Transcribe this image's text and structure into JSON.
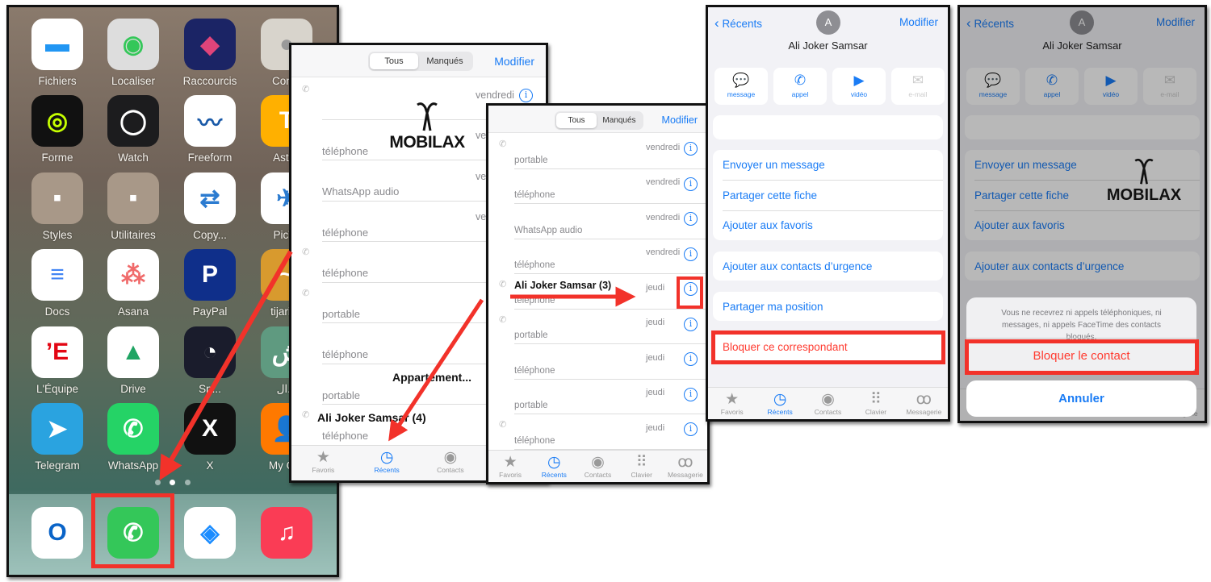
{
  "home": {
    "apps": [
      {
        "label": "Fichiers",
        "icon": "folder-icon",
        "color": "#2196f3",
        "bg": "#fff"
      },
      {
        "label": "Localiser",
        "icon": "find-my-icon",
        "color": "#34c759",
        "bg": "#ddd"
      },
      {
        "label": "Raccourcis",
        "icon": "shortcuts-icon",
        "color": "#e0447a",
        "bg": "#1b2465"
      },
      {
        "label": "Conta",
        "icon": "contacts-icon",
        "color": "#999",
        "bg": "#d8d4cc"
      },
      {
        "label": "Forme",
        "icon": "fitness-rings-icon",
        "color": "#c6ff00",
        "bg": "#111"
      },
      {
        "label": "Watch",
        "icon": "watch-icon",
        "color": "#fff",
        "bg": "#1c1c1e"
      },
      {
        "label": "Freeform",
        "icon": "freeform-icon",
        "color": "#1a5aa8",
        "bg": "#fff"
      },
      {
        "label": "Astuc",
        "icon": "tips-lightbulb-icon",
        "color": "#fff",
        "bg": "#ffb000"
      },
      {
        "label": "Styles",
        "icon": "folder-styles-icon",
        "color": "#fff",
        "bg": "#a89888"
      },
      {
        "label": "Utilitaires",
        "icon": "folder-utilities-icon",
        "color": "#fff",
        "bg": "#a89888"
      },
      {
        "label": "Copy...",
        "icon": "copy-data-icon",
        "color": "#2b7bd0",
        "bg": "#fff",
        "cloud": true
      },
      {
        "label": "PicTo",
        "icon": "rocket-icon",
        "color": "#2b7bd0",
        "bg": "#fff"
      },
      {
        "label": "Docs",
        "icon": "google-docs-icon",
        "color": "#4285f4",
        "bg": "#fff"
      },
      {
        "label": "Asana",
        "icon": "asana-icon",
        "color": "#f06a6a",
        "bg": "#fff",
        "cloud": true
      },
      {
        "label": "PayPal",
        "icon": "paypal-icon",
        "color": "#fff",
        "bg": "#0f2f8a"
      },
      {
        "label": "tijari M",
        "icon": "attijari-icon",
        "color": "#fff",
        "bg": "#d89a2e"
      },
      {
        "label": "L'Équipe",
        "icon": "lequipe-icon",
        "color": "#e30613",
        "bg": "#fff"
      },
      {
        "label": "Drive",
        "icon": "google-drive-icon",
        "color": "#1fa463",
        "bg": "#fff"
      },
      {
        "label": "Sp...",
        "icon": "speedtest-icon",
        "color": "#fff",
        "bg": "#1a1c2c",
        "cloud": true
      },
      {
        "label": "ال...",
        "icon": "arabic-app-icon",
        "color": "#fff",
        "bg": "#5f9a80",
        "cloud": true
      },
      {
        "label": "Telegram",
        "icon": "telegram-icon",
        "color": "#fff",
        "bg": "#2aa3e0"
      },
      {
        "label": "WhatsApp",
        "icon": "whatsapp-icon",
        "color": "#fff",
        "bg": "#25d366"
      },
      {
        "label": "X",
        "icon": "x-icon",
        "color": "#fff",
        "bg": "#111"
      },
      {
        "label": "My Ora",
        "icon": "my-orange-icon",
        "color": "#fff",
        "bg": "#ff7900"
      }
    ],
    "glyphs": [
      "▬",
      "◉",
      "◆",
      "●",
      "◎",
      "◯",
      "〰",
      "T",
      "▪",
      "▪",
      "⇄",
      "✈",
      "≡",
      "⁂",
      "P",
      "~",
      "’E",
      "▲",
      "◔",
      "ش",
      "➤",
      "✆",
      "X",
      "👤"
    ],
    "dock": [
      {
        "icon": "outlook-icon",
        "bg": "#fff",
        "color": "#0a64c8",
        "glyph": "O"
      },
      {
        "icon": "phone-icon",
        "bg": "#34c759",
        "color": "#fff",
        "glyph": "✆"
      },
      {
        "icon": "safari-icon",
        "bg": "#fff",
        "color": "#1a8cff",
        "glyph": "◈"
      },
      {
        "icon": "music-icon",
        "bg": "#fa3c55",
        "color": "#fff",
        "glyph": "♫"
      }
    ]
  },
  "recents_list": {
    "segments": [
      "Tous",
      "Manqués"
    ],
    "edit": "Modifier",
    "watermark": "MOBILAX",
    "rows": [
      {
        "name": "",
        "sub": "",
        "date": "vendredi",
        "outgoing": true
      },
      {
        "name": "",
        "sub": "téléphone",
        "date": "vendredi",
        "outgoing": false
      },
      {
        "name": "",
        "sub": "WhatsApp audio",
        "date": "vendredi",
        "outgoing": false
      },
      {
        "name": "",
        "sub": "téléphone",
        "date": "vendredi",
        "outgoing": false
      },
      {
        "name": "",
        "sub": "téléphone",
        "date": "",
        "outgoing": true
      },
      {
        "name": "",
        "sub": "portable",
        "date": "",
        "outgoing": true
      },
      {
        "name": "",
        "sub": "téléphone",
        "date": "",
        "outgoing": false
      },
      {
        "name": "Appartement...",
        "sub": "portable",
        "date": "",
        "outgoing": false
      },
      {
        "name": "Ali Joker Samsar (4)",
        "sub": "téléphone",
        "date": "",
        "outgoing": true
      }
    ]
  },
  "recents_zoom": {
    "segments": [
      "Tous",
      "Manqués"
    ],
    "edit": "Modifier",
    "rows": [
      {
        "name": "",
        "sub": "portable",
        "date": "vendredi",
        "outgoing": true
      },
      {
        "name": "",
        "sub": "téléphone",
        "date": "vendredi",
        "outgoing": false
      },
      {
        "name": "",
        "sub": "WhatsApp audio",
        "date": "vendredi",
        "outgoing": false
      },
      {
        "name": "",
        "sub": "téléphone",
        "date": "vendredi",
        "outgoing": false
      },
      {
        "name": "Ali Joker Samsar (3)",
        "sub": "téléphone",
        "date": "jeudi",
        "outgoing": true
      },
      {
        "name": "",
        "sub": "portable",
        "date": "jeudi",
        "outgoing": true
      },
      {
        "name": "",
        "sub": "téléphone",
        "date": "jeudi",
        "outgoing": false
      },
      {
        "name": "",
        "sub": "portable",
        "date": "jeudi",
        "outgoing": false
      },
      {
        "name": "",
        "sub": "téléphone",
        "date": "jeudi",
        "outgoing": true
      }
    ]
  },
  "tabs": [
    {
      "label": "Favoris",
      "icon": "star-icon",
      "glyph": "★"
    },
    {
      "label": "Récents",
      "icon": "clock-icon",
      "glyph": "◷",
      "active": true
    },
    {
      "label": "Contacts",
      "icon": "person-circle-icon",
      "glyph": "◉"
    },
    {
      "label": "Clavier",
      "icon": "keypad-icon",
      "glyph": "⠿"
    },
    {
      "label": "Messagerie",
      "icon": "voicemail-icon",
      "glyph": "ꝏ"
    }
  ],
  "contact": {
    "back": "Récents",
    "edit": "Modifier",
    "avatar": "A",
    "name": "Ali Joker Samsar",
    "actions": [
      {
        "label": "message",
        "icon": "message-bubble-icon",
        "glyph": "💬"
      },
      {
        "label": "appel",
        "icon": "phone-icon",
        "glyph": "✆"
      },
      {
        "label": "vidéo",
        "icon": "video-camera-icon",
        "glyph": "▶"
      },
      {
        "label": "e-mail",
        "icon": "envelope-icon",
        "glyph": "✉",
        "disabled": true
      }
    ],
    "options": [
      "Envoyer un message",
      "Partager cette fiche",
      "Ajouter aux favoris"
    ],
    "emergency": "Ajouter aux contacts d’urgence",
    "share_location": "Partager ma position",
    "block": "Bloquer ce correspondant"
  },
  "block_sheet": {
    "message": "Vous ne recevrez ni appels téléphoniques, ni messages, ni appels FaceTime des contacts bloqués.",
    "confirm": "Bloquer le contact",
    "cancel": "Annuler",
    "watermark": "MOBILAX"
  },
  "colors": {
    "accent": "#1a7cf5",
    "highlight": "#f2322a",
    "destructive": "#ff3b30"
  }
}
